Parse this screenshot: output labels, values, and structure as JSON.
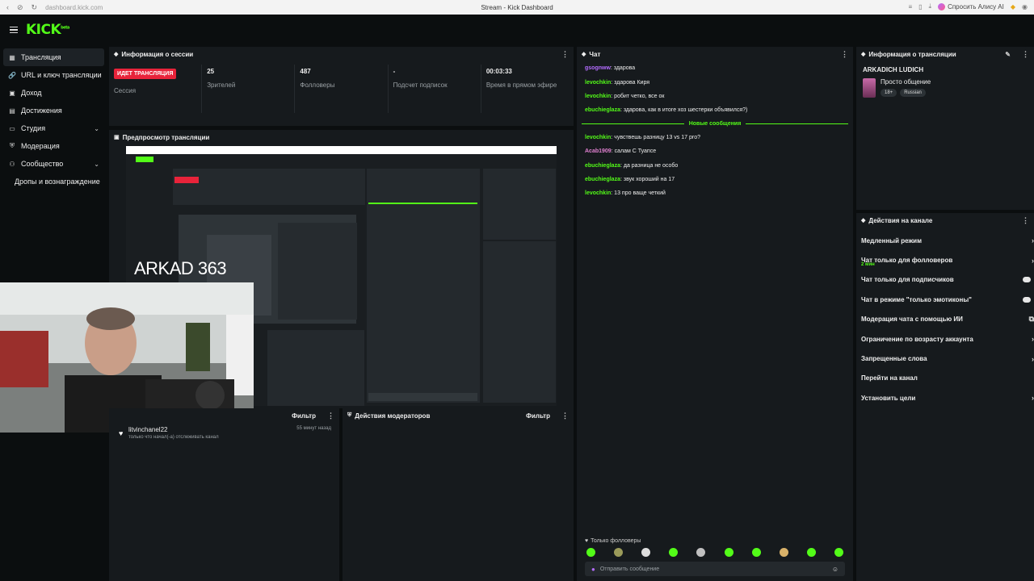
{
  "browser": {
    "url": "dashboard.kick.com",
    "tab_title": "Stream - Kick Dashboard",
    "alice_button": "Спросить Алису AI"
  },
  "logo": {
    "text": "KICK",
    "badge": "beta"
  },
  "sidebar": {
    "items": [
      {
        "label": "Трансляция",
        "icon": "broadcast-icon"
      },
      {
        "label": "URL и ключ трансляции",
        "icon": "key-icon"
      },
      {
        "label": "Доход",
        "icon": "wallet-icon"
      },
      {
        "label": "Достижения",
        "icon": "trophy-icon"
      },
      {
        "label": "Студия",
        "icon": "studio-icon"
      },
      {
        "label": "Модерация",
        "icon": "shield-icon"
      },
      {
        "label": "Сообщество",
        "icon": "community-icon"
      },
      {
        "label": "Дропы и вознаграждение",
        "icon": ""
      }
    ]
  },
  "session": {
    "title": "Информация о сессии",
    "live_badge": "ИДЕТ ТРАНСЛЯЦИЯ",
    "session_label": "Сессия",
    "viewers_value": "25",
    "viewers_label": "Зрителей",
    "followers_value": "487",
    "followers_label": "Фолловеры",
    "subs_value": "-",
    "subs_label": "Подсчет подписок",
    "uptime_value": "00:03:33",
    "uptime_label": "Время в прямом эфире"
  },
  "preview": {
    "title": "Предпросмотр трансляции",
    "overlay_text": "ARKAD  363"
  },
  "activity": {
    "filter_label": "Фильтр",
    "items": [
      {
        "user": "litvinchanel22",
        "text": "только что начал(-а) отслеживать канал",
        "time": "55 минут назад"
      }
    ]
  },
  "mod_actions": {
    "title": "Действия модераторов",
    "filter_label": "Фильтр"
  },
  "chat": {
    "title": "Чат",
    "messages": [
      {
        "user": "gsognww",
        "text": ": здарова",
        "color": "#b36cff"
      },
      {
        "user": "levochkin",
        "text": ": здарова Киря",
        "color": "#53fc18"
      },
      {
        "user": "levochkin",
        "text": ": робит четко, все ок",
        "color": "#53fc18"
      },
      {
        "user": "ebuchieglaza",
        "text": ": здарова, как в итоге хоз шестерки объявился?)",
        "color": "#53fc18"
      }
    ],
    "new_messages_label": "Новые сообщения",
    "new_messages": [
      {
        "user": "levochkin",
        "text": ": чувствешь разницу 13 vs 17 pro?",
        "color": "#53fc18"
      },
      {
        "user": "Acab1909",
        "text": ": салам С Туапсе",
        "color": "#e080d0"
      },
      {
        "user": "ebuchieglaza",
        "text": ": да разница не особо",
        "color": "#53fc18"
      },
      {
        "user": "ebuchieglaza",
        "text": ": звук хороший на 17",
        "color": "#53fc18"
      },
      {
        "user": "levochkin",
        "text": ": 13 про ваще четкий",
        "color": "#53fc18"
      }
    ],
    "followers_only": "Только фолловеры",
    "input_placeholder": "Отправить сообщение"
  },
  "stream_info": {
    "title": "Информация о трансляции",
    "streamer": "ARKADICH LUDICH",
    "category": "Просто общение",
    "tags": [
      "18+",
      "Russian"
    ]
  },
  "channel_actions": {
    "title": "Действия на канале",
    "items": [
      {
        "label": "Медленный режим",
        "sub": "",
        "control": "arrow"
      },
      {
        "label": "Чат только для фолловеров",
        "sub": "2 мин",
        "control": "arrow"
      },
      {
        "label": "Чат только для подписчиков",
        "sub": "",
        "control": "toggle"
      },
      {
        "label": "Чат в режиме \"только эмотиконы\"",
        "sub": "",
        "control": "toggle"
      },
      {
        "label": "Модерация чата с помощью ИИ",
        "sub": "",
        "control": "none"
      },
      {
        "label": "Ограничение по возрасту аккаунта",
        "sub": "",
        "control": "arrow"
      },
      {
        "label": "Запрещенные слова",
        "sub": "",
        "control": "arrow"
      },
      {
        "label": "Перейти на канал",
        "sub": "",
        "control": "none"
      },
      {
        "label": "Установить цели",
        "sub": "",
        "control": "arrow"
      }
    ]
  },
  "colors": {
    "accent": "#53fc18",
    "live": "#e8233a",
    "panel": "#161a1d",
    "bg": "#0b0e0f"
  }
}
